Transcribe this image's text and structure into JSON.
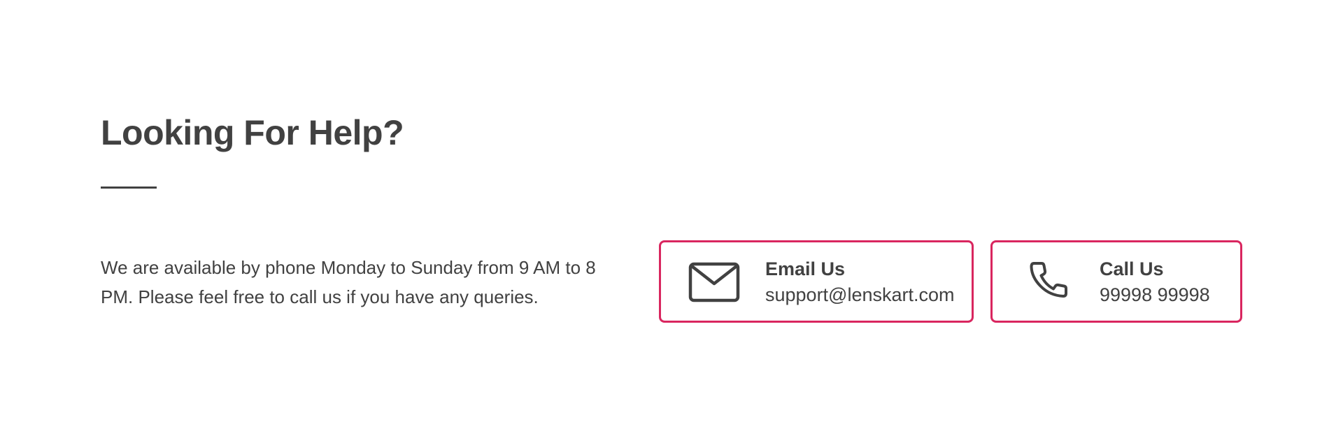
{
  "help": {
    "title": "Looking For Help?",
    "description": "We are available by phone Monday to Sunday from 9 AM to 8 PM. Please feel free to call us if you have any queries.",
    "accent_color": "#d9265f",
    "text_color": "#414141"
  },
  "contacts": {
    "email": {
      "heading": "Email Us",
      "value": "support@lenskart.com",
      "icon": "envelope-icon"
    },
    "phone": {
      "heading": "Call Us",
      "value": "99998 99998",
      "icon": "phone-icon"
    }
  }
}
